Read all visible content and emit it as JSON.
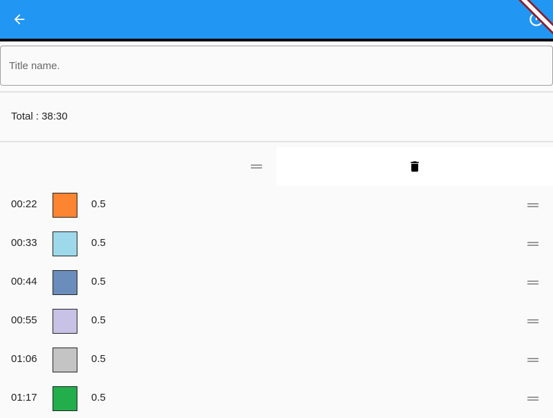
{
  "app_bar": {
    "back_icon": "arrow-back-icon",
    "action_icon": "power-icon",
    "background": "#2196f3"
  },
  "title_input": {
    "placeholder": "Title name.",
    "value": ""
  },
  "total": {
    "text": "Total : 38:30"
  },
  "dismissed_row": {
    "handle_icon": "drag-handle-icon",
    "delete_icon": "delete-icon"
  },
  "items": [
    {
      "time": "00:22",
      "color": "#fd8430",
      "value": "0.5"
    },
    {
      "time": "00:33",
      "color": "#9ed9eb",
      "value": "0.5"
    },
    {
      "time": "00:44",
      "color": "#6b8dbb",
      "value": "0.5"
    },
    {
      "time": "00:55",
      "color": "#c8c2e6",
      "value": "0.5"
    },
    {
      "time": "01:06",
      "color": "#c4c4c4",
      "value": "0.5"
    },
    {
      "time": "01:17",
      "color": "#21ae4b",
      "value": "0.5"
    }
  ]
}
